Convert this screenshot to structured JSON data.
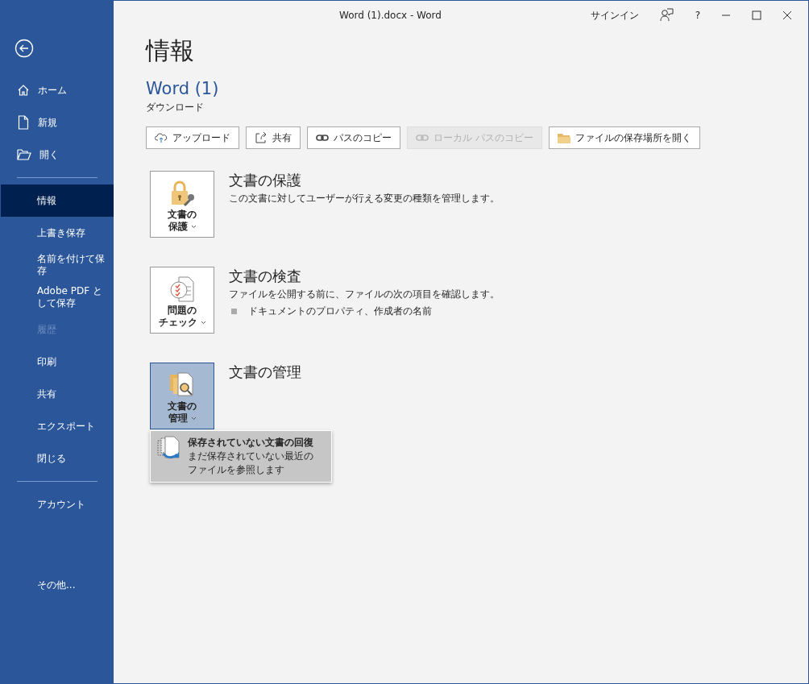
{
  "window": {
    "title": "Word (1).docx  -  Word",
    "sign_in": "サインイン",
    "help": "?"
  },
  "sidebar": {
    "top_items": [
      {
        "label": "ホーム"
      },
      {
        "label": "新規"
      },
      {
        "label": "開く"
      }
    ],
    "items": [
      {
        "label": "情報",
        "selected": true,
        "disabled": false
      },
      {
        "label": "上書き保存",
        "selected": false,
        "disabled": false
      },
      {
        "label": "名前を付けて保存",
        "selected": false,
        "disabled": false
      },
      {
        "label": "Adobe PDF として保存",
        "selected": false,
        "disabled": false
      },
      {
        "label": "履歴",
        "selected": false,
        "disabled": true
      },
      {
        "label": "印刷",
        "selected": false,
        "disabled": false
      },
      {
        "label": "共有",
        "selected": false,
        "disabled": false
      },
      {
        "label": "エクスポート",
        "selected": false,
        "disabled": false
      },
      {
        "label": "閉じる",
        "selected": false,
        "disabled": false
      }
    ],
    "account": "アカウント",
    "more": "その他..."
  },
  "page": {
    "heading": "情報",
    "doc_name": "Word (1)",
    "location": "ダウンロード"
  },
  "actions": [
    {
      "label": "アップロード",
      "disabled": false
    },
    {
      "label": "共有",
      "disabled": false
    },
    {
      "label": "パスのコピー",
      "disabled": false
    },
    {
      "label": "ローカル パスのコピー",
      "disabled": true
    },
    {
      "label": "ファイルの保存場所を開く",
      "disabled": false
    }
  ],
  "sections": [
    {
      "tile": [
        "文書の",
        "保護"
      ],
      "selected": false,
      "title": "文書の保護",
      "description": "この文書に対してユーザーが行える変更の種類を管理します。"
    },
    {
      "tile": [
        "問題の",
        "チェック"
      ],
      "selected": false,
      "title": "文書の検査",
      "description": "ファイルを公開する前に、ファイルの次の項目を確認します。",
      "bullets": [
        "ドキュメントのプロパティ、作成者の名前"
      ]
    },
    {
      "tile": [
        "文書の",
        "管理"
      ],
      "selected": true,
      "title": "文書の管理"
    }
  ],
  "menu": {
    "items": [
      {
        "title": "保存されていない文書の回復",
        "description": "まだ保存されていない最近のファイルを参照します",
        "selected": true
      }
    ]
  }
}
